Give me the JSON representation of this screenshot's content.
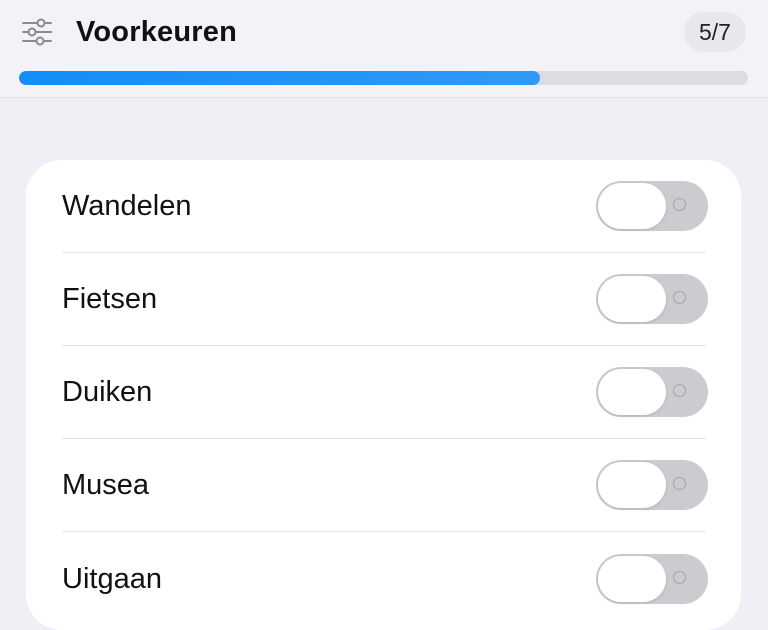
{
  "header": {
    "settings_icon": "sliders-icon",
    "title": "Voorkeuren",
    "step": "5/7",
    "progress_fraction": 0.714,
    "accent_color": "#1a8ff7"
  },
  "preferences": [
    {
      "label": "Wandelen",
      "enabled": false
    },
    {
      "label": "Fietsen",
      "enabled": false
    },
    {
      "label": "Duiken",
      "enabled": false
    },
    {
      "label": "Musea",
      "enabled": false
    },
    {
      "label": "Uitgaan",
      "enabled": false
    }
  ]
}
